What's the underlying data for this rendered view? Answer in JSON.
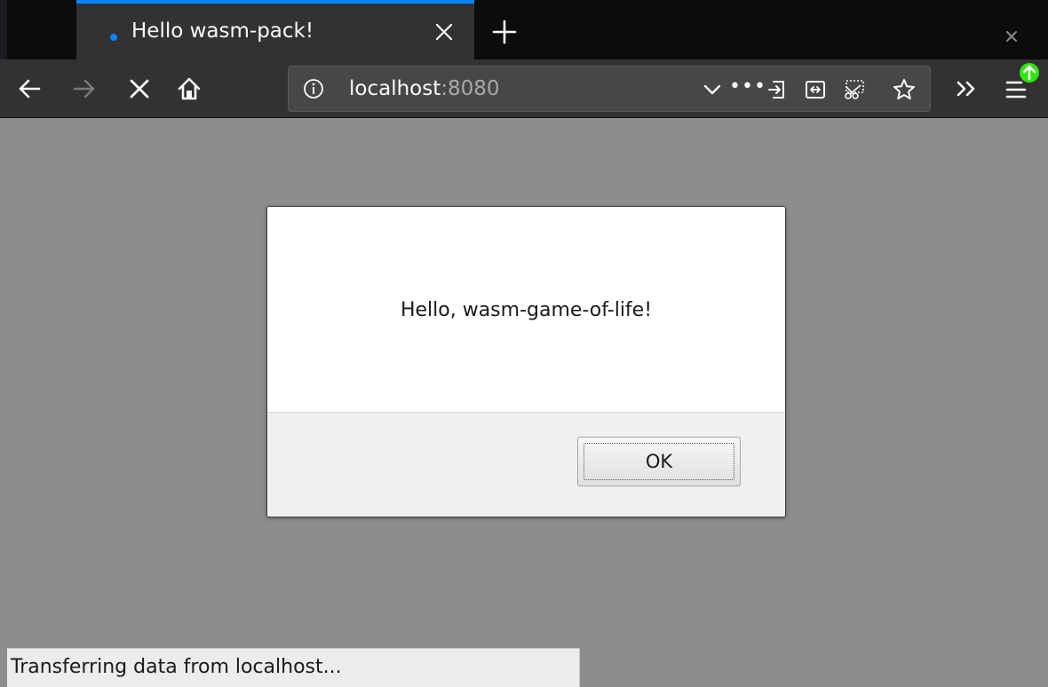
{
  "browser": {
    "tab": {
      "title": "Hello wasm-pack!"
    },
    "urlbar": {
      "host": "localhost",
      "port": ":8080"
    },
    "page_actions_label": "•••"
  },
  "dialog": {
    "message": "Hello, wasm-game-of-life!",
    "ok_label": "OK"
  },
  "status_bar": {
    "text": "Transferring data from localhost..."
  },
  "icons": {
    "tab": [
      "loading-dot-icon",
      "close-tab-icon",
      "new-tab-icon",
      "window-close-icon"
    ],
    "toolbar": [
      "back-icon",
      "forward-icon",
      "stop-icon",
      "home-icon",
      "info-icon",
      "dropdown-icon",
      "page-actions-icon",
      "reader-view-icon",
      "screenshot-icon",
      "clip-icon",
      "bookmark-star-icon",
      "overflow-icon",
      "menu-icon",
      "update-badge-icon"
    ]
  },
  "colors": {
    "accent": "#0a84ff",
    "update_badge": "#30e60b",
    "chrome_dark": "#0c0c0d",
    "toolbar": "#323234",
    "content_bg": "#8d8d8d"
  }
}
